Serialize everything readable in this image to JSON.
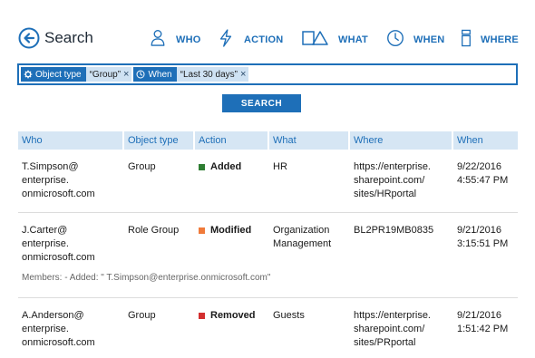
{
  "header": {
    "title": "Search",
    "nav": [
      {
        "label": "WHO",
        "icon": "person-icon"
      },
      {
        "label": "ACTION",
        "icon": "lightning-icon"
      },
      {
        "label": "WHAT",
        "icon": "shapes-icon"
      },
      {
        "label": "WHEN",
        "icon": "clock-icon"
      },
      {
        "label": "WHERE",
        "icon": "server-icon"
      }
    ]
  },
  "search": {
    "filters": [
      {
        "field": "Object type",
        "field_icon": "gear-icon",
        "value": "“Group”",
        "remove": "×"
      },
      {
        "field": "When",
        "field_icon": "clock-icon",
        "value": "“Last 30 days”",
        "remove": "×"
      }
    ],
    "input_value": "",
    "button_label": "SEARCH"
  },
  "table": {
    "columns": [
      "Who",
      "Object type",
      "Action",
      "What",
      "Where",
      "When"
    ],
    "rows": [
      {
        "who": [
          "T.Simpson@",
          "enterprise.",
          "onmicrosoft.com"
        ],
        "object_type": "Group",
        "action": "Added",
        "action_color": "#2e7d32",
        "what": [
          "HR"
        ],
        "where": [
          "https://enterprise.",
          "sharepoint.com/",
          "sites/HRportal"
        ],
        "when": [
          "9/22/2016",
          "4:55:47 PM"
        ],
        "detail": ""
      },
      {
        "who": [
          "J.Carter@",
          "enterprise.",
          "onmicrosoft.com"
        ],
        "object_type": "Role Group",
        "action": "Modified",
        "action_color": "#f07a3a",
        "what": [
          "Organization",
          "Management"
        ],
        "where": [
          "BL2PR19MB0835"
        ],
        "when": [
          "9/21/2016",
          "3:15:51 PM"
        ],
        "detail": "Members: - Added: \" T.Simpson@enterprise.onmicrosoft.com\""
      },
      {
        "who": [
          "A.Anderson@",
          "enterprise.",
          "onmicrosoft.com"
        ],
        "object_type": "Group",
        "action": "Removed",
        "action_color": "#d32f2f",
        "what": [
          "Guests"
        ],
        "where": [
          "https://enterprise.",
          "sharepoint.com/",
          "sites/PRportal"
        ],
        "when": [
          "9/21/2016",
          "1:51:42 PM"
        ],
        "detail": ""
      }
    ]
  },
  "colors": {
    "accent": "#1e6fb8",
    "header_bg": "#d6e6f4",
    "chip_value_bg": "#cfe2f3"
  }
}
